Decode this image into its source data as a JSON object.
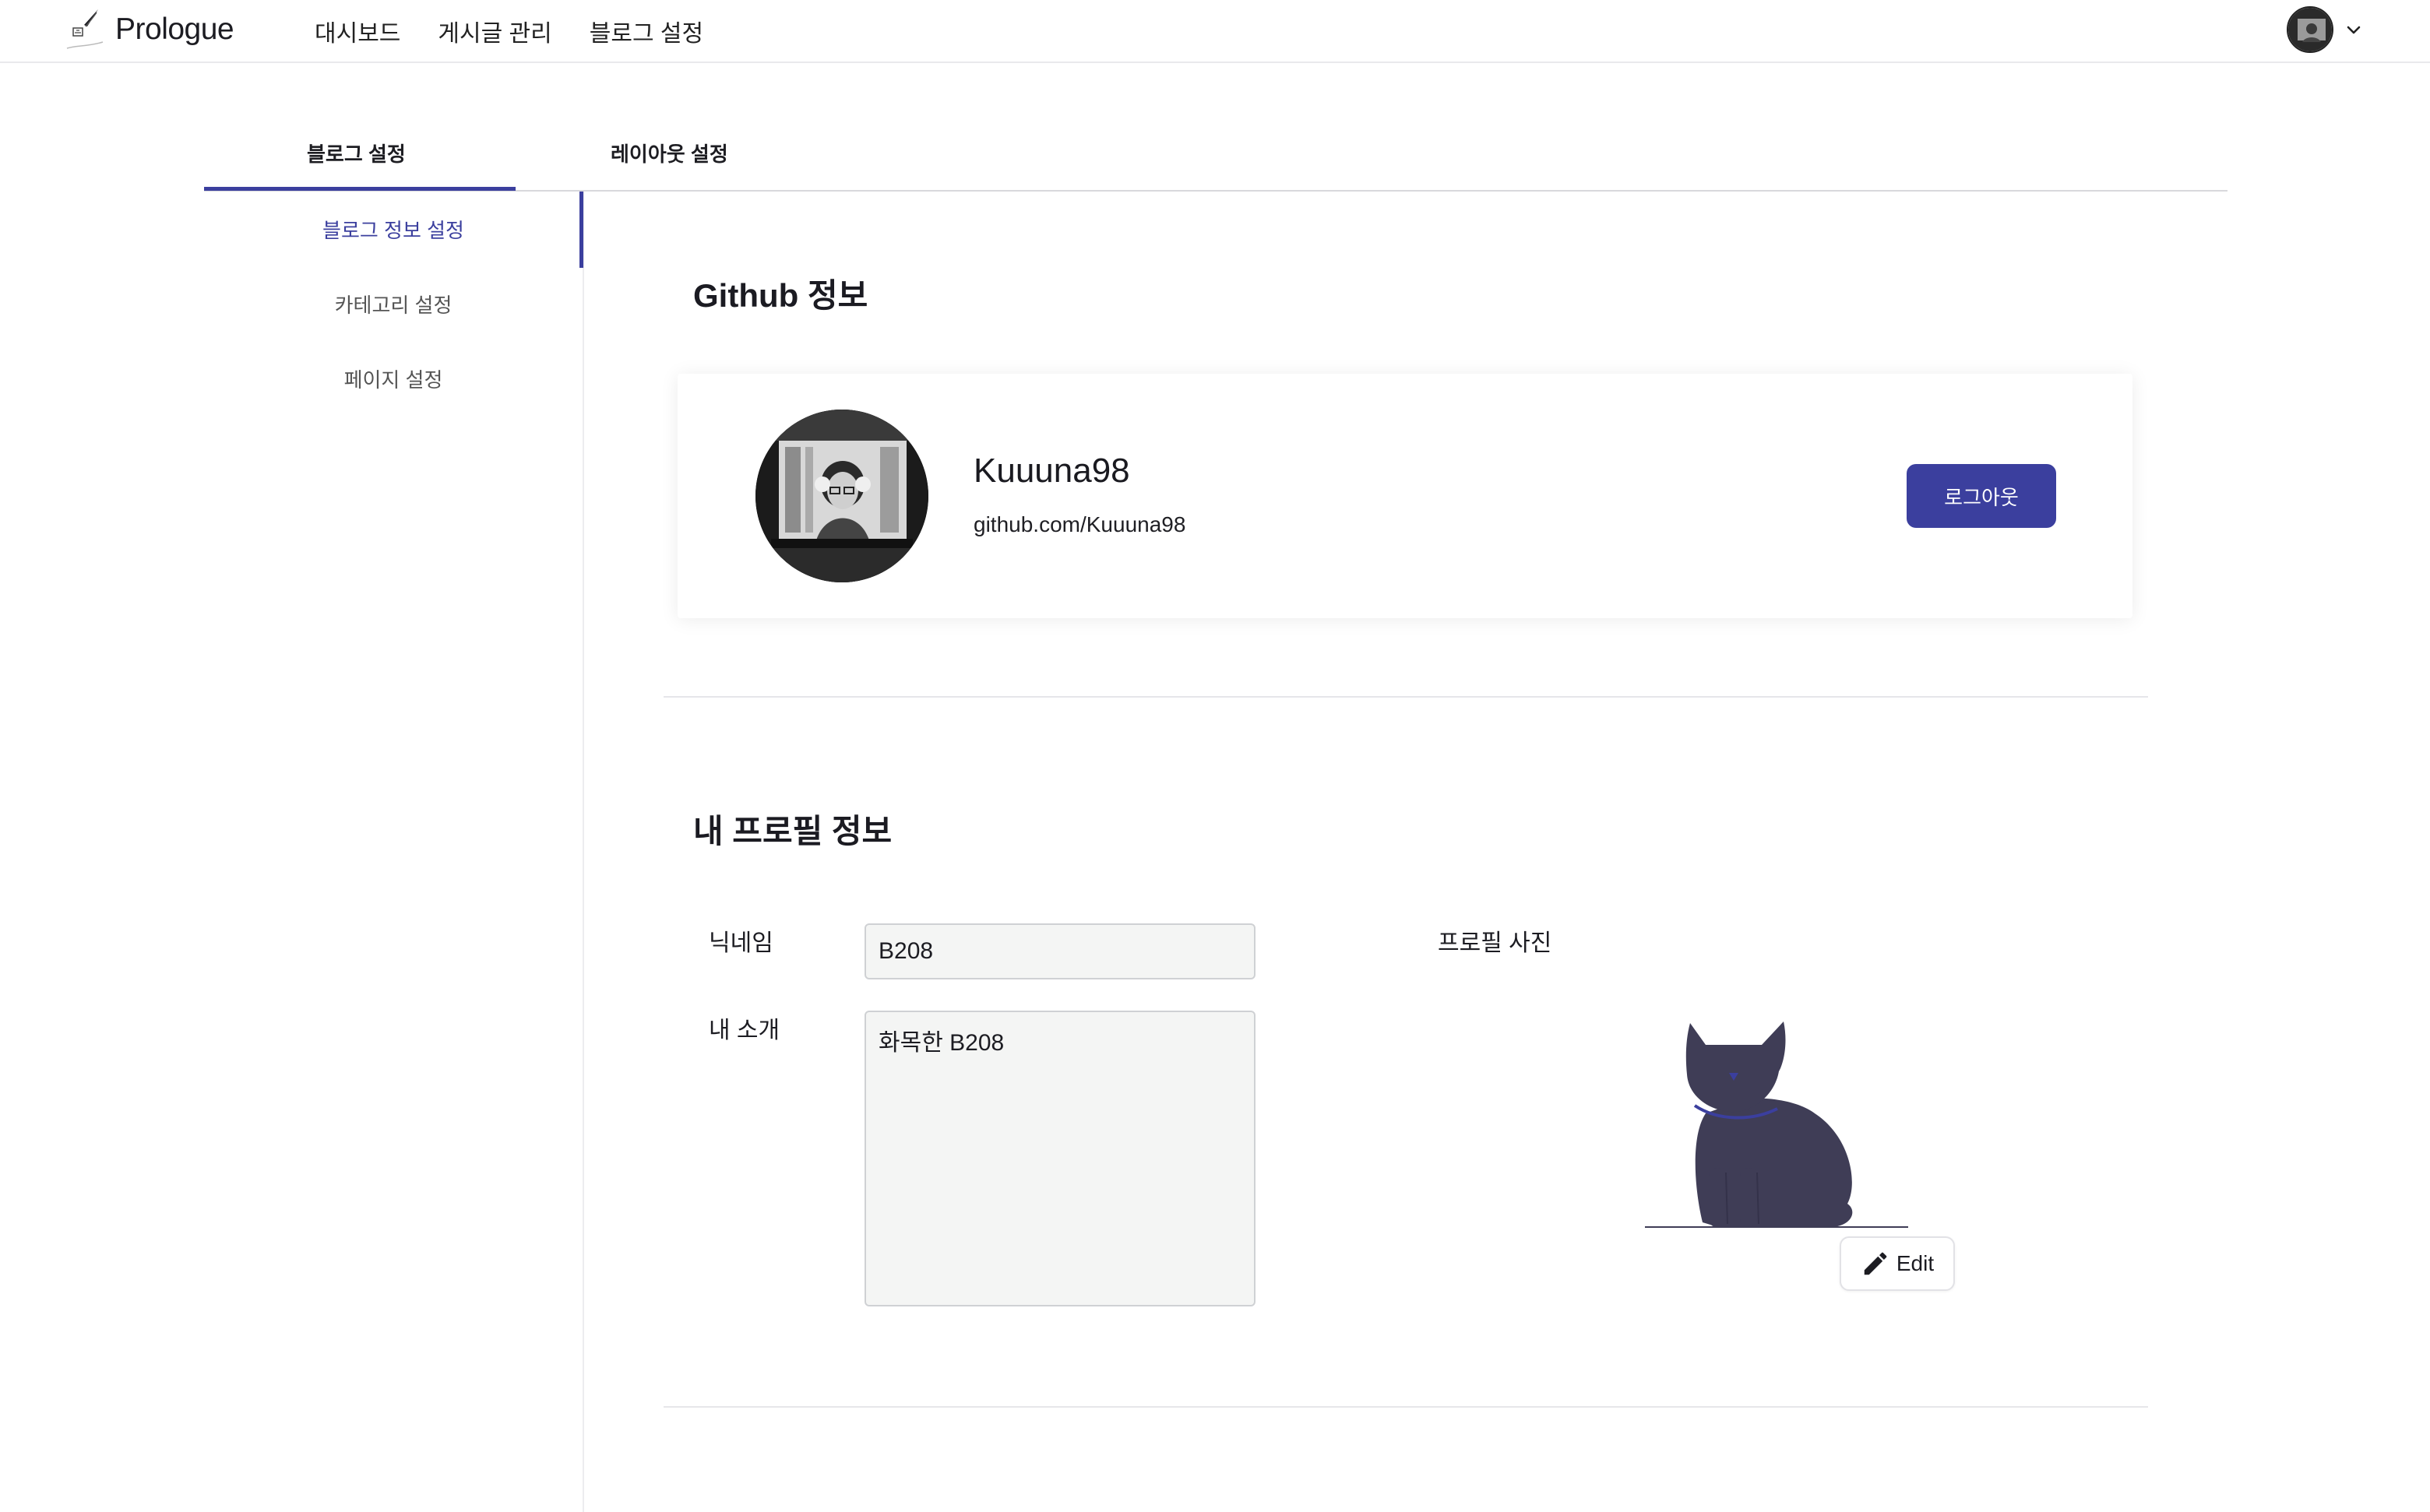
{
  "app": {
    "name": "Prologue"
  },
  "nav": {
    "items": [
      {
        "label": "대시보드"
      },
      {
        "label": "게시글 관리"
      },
      {
        "label": "블로그 설정"
      }
    ]
  },
  "tabs": [
    {
      "label": "블로그 설정",
      "active": true
    },
    {
      "label": "레이아웃 설정",
      "active": false
    }
  ],
  "sidebar": {
    "items": [
      {
        "label": "블로그 정보 설정",
        "active": true
      },
      {
        "label": "카테고리 설정",
        "active": false
      },
      {
        "label": "페이지 설정",
        "active": false
      }
    ]
  },
  "github": {
    "section_title": "Github 정보",
    "username": "Kuuuna98",
    "url": "github.com/Kuuuna98",
    "logout_label": "로그아웃"
  },
  "profile": {
    "section_title": "내 프로필 정보",
    "nickname_label": "닉네임",
    "nickname_value": "B208",
    "intro_label": "내 소개",
    "intro_value": "화목한 B208",
    "photo_label": "프로필 사진",
    "edit_label": "Edit"
  },
  "colors": {
    "accent": "#3b3f9e",
    "cat": "#3f3d56",
    "collar": "#3b3f9e"
  },
  "icons": {
    "logo": "quill-logo-icon",
    "user_menu": "chevron-down-icon",
    "edit": "pencil-icon"
  }
}
